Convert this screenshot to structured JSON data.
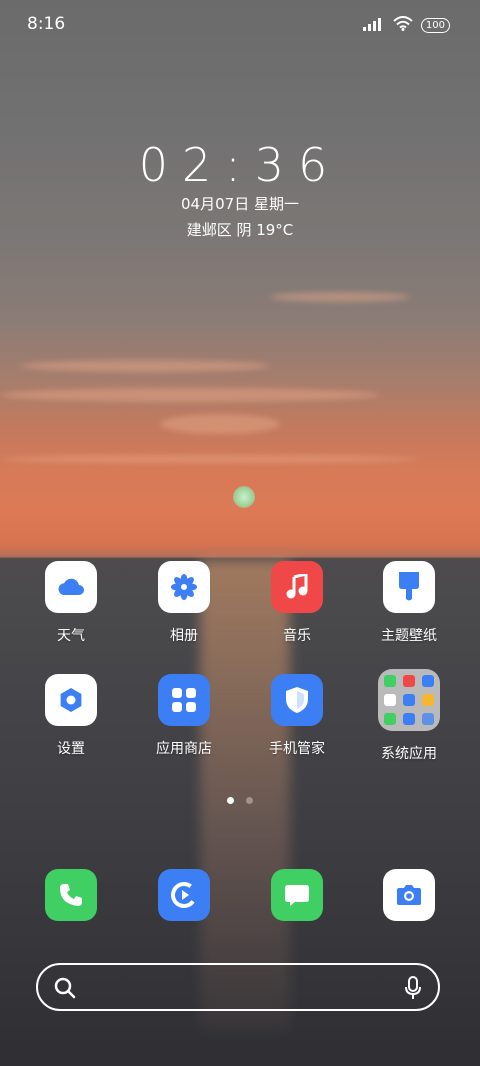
{
  "status": {
    "time": "8:16",
    "battery": "100"
  },
  "lockclock": {
    "time": "02:36",
    "date": "04月07日 星期一",
    "weather": "建邺区 阴 19°C"
  },
  "apps": {
    "row1": [
      {
        "label": "天气",
        "icon": "cloud-icon"
      },
      {
        "label": "相册",
        "icon": "flower-icon"
      },
      {
        "label": "音乐",
        "icon": "music-note-icon"
      },
      {
        "label": "主题壁纸",
        "icon": "paint-brush-icon"
      }
    ],
    "row2": [
      {
        "label": "设置",
        "icon": "gear-icon"
      },
      {
        "label": "应用商店",
        "icon": "grid-icon"
      },
      {
        "label": "手机管家",
        "icon": "shield-icon"
      },
      {
        "label": "系统应用",
        "icon": "folder-icon"
      }
    ]
  },
  "pages": {
    "count": 2,
    "current": 1
  },
  "dock": [
    {
      "icon": "phone-icon"
    },
    {
      "icon": "browser-icon"
    },
    {
      "icon": "message-icon"
    },
    {
      "icon": "camera-icon"
    }
  ],
  "colors": {
    "blue": "#3c7ff5",
    "red": "#f04848",
    "green": "#3fcf62"
  }
}
